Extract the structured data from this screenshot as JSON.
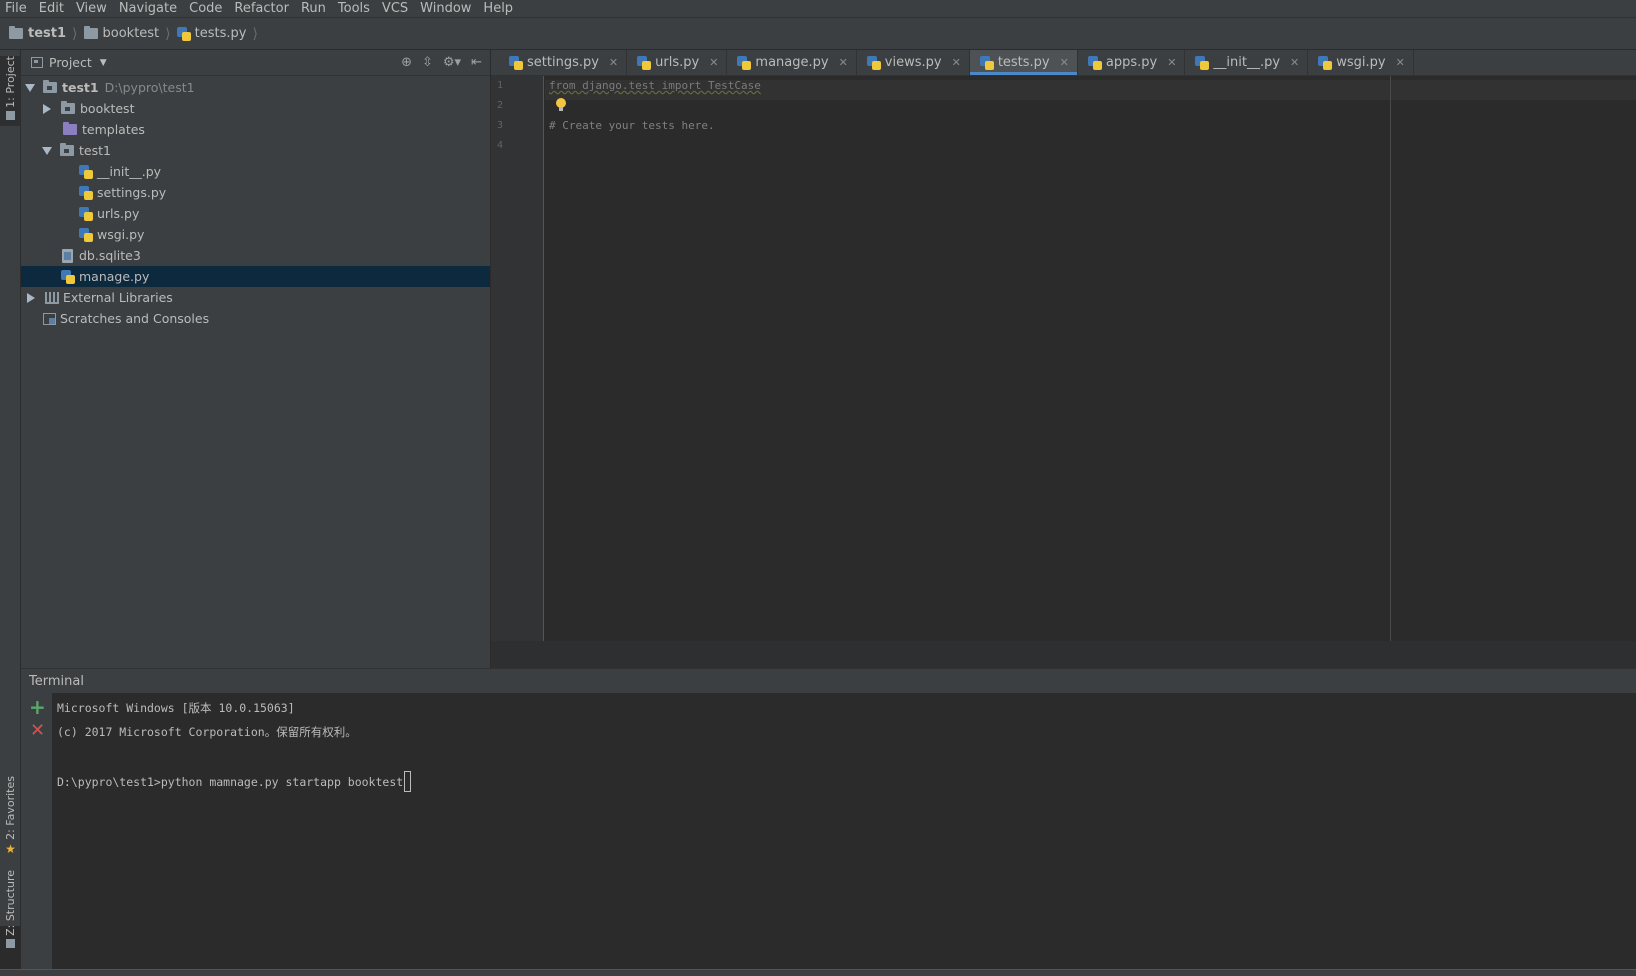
{
  "menu": [
    "File",
    "Edit",
    "View",
    "Navigate",
    "Code",
    "Refactor",
    "Run",
    "Tools",
    "VCS",
    "Window",
    "Help"
  ],
  "breadcrumb": [
    "test1",
    "booktest",
    "tests.py"
  ],
  "left_strip": {
    "project_tab": "1: Project",
    "favorites_tab": "2: Favorites",
    "structure_tab": "Z: Structure"
  },
  "project_panel": {
    "title": "Project",
    "root": {
      "label": "test1",
      "path": "D:\\pypro\\test1"
    },
    "items": [
      {
        "label": "booktest",
        "type": "folder"
      },
      {
        "label": "templates",
        "type": "folder-purple"
      },
      {
        "label": "test1",
        "type": "folder"
      },
      {
        "label": "__init__.py",
        "type": "py"
      },
      {
        "label": "settings.py",
        "type": "py"
      },
      {
        "label": "urls.py",
        "type": "py"
      },
      {
        "label": "wsgi.py",
        "type": "py"
      },
      {
        "label": "db.sqlite3",
        "type": "db"
      },
      {
        "label": "manage.py",
        "type": "py",
        "selected": true
      },
      {
        "label": "External Libraries",
        "type": "lib"
      },
      {
        "label": "Scratches and Consoles",
        "type": "scratch"
      }
    ]
  },
  "editor_tabs": [
    {
      "label": "settings.py"
    },
    {
      "label": "urls.py"
    },
    {
      "label": "manage.py"
    },
    {
      "label": "views.py"
    },
    {
      "label": "tests.py",
      "active": true
    },
    {
      "label": "apps.py"
    },
    {
      "label": "__init__.py"
    },
    {
      "label": "wsgi.py"
    }
  ],
  "editor": {
    "line_numbers": [
      "1",
      "2",
      "3",
      "4"
    ],
    "line1": "from django.test import TestCase",
    "line3": "# Create your tests here."
  },
  "terminal": {
    "title": "Terminal",
    "line1": "Microsoft Windows [版本 10.0.15063]",
    "line2": "(c) 2017 Microsoft Corporation。保留所有权利。",
    "line4": "D:\\pypro\\test1>python mamnage.py startapp booktest"
  },
  "colors": {
    "accent": "#4a88c7",
    "selection": "#0d293e",
    "add": "#59a869",
    "close": "#d94f4f"
  }
}
